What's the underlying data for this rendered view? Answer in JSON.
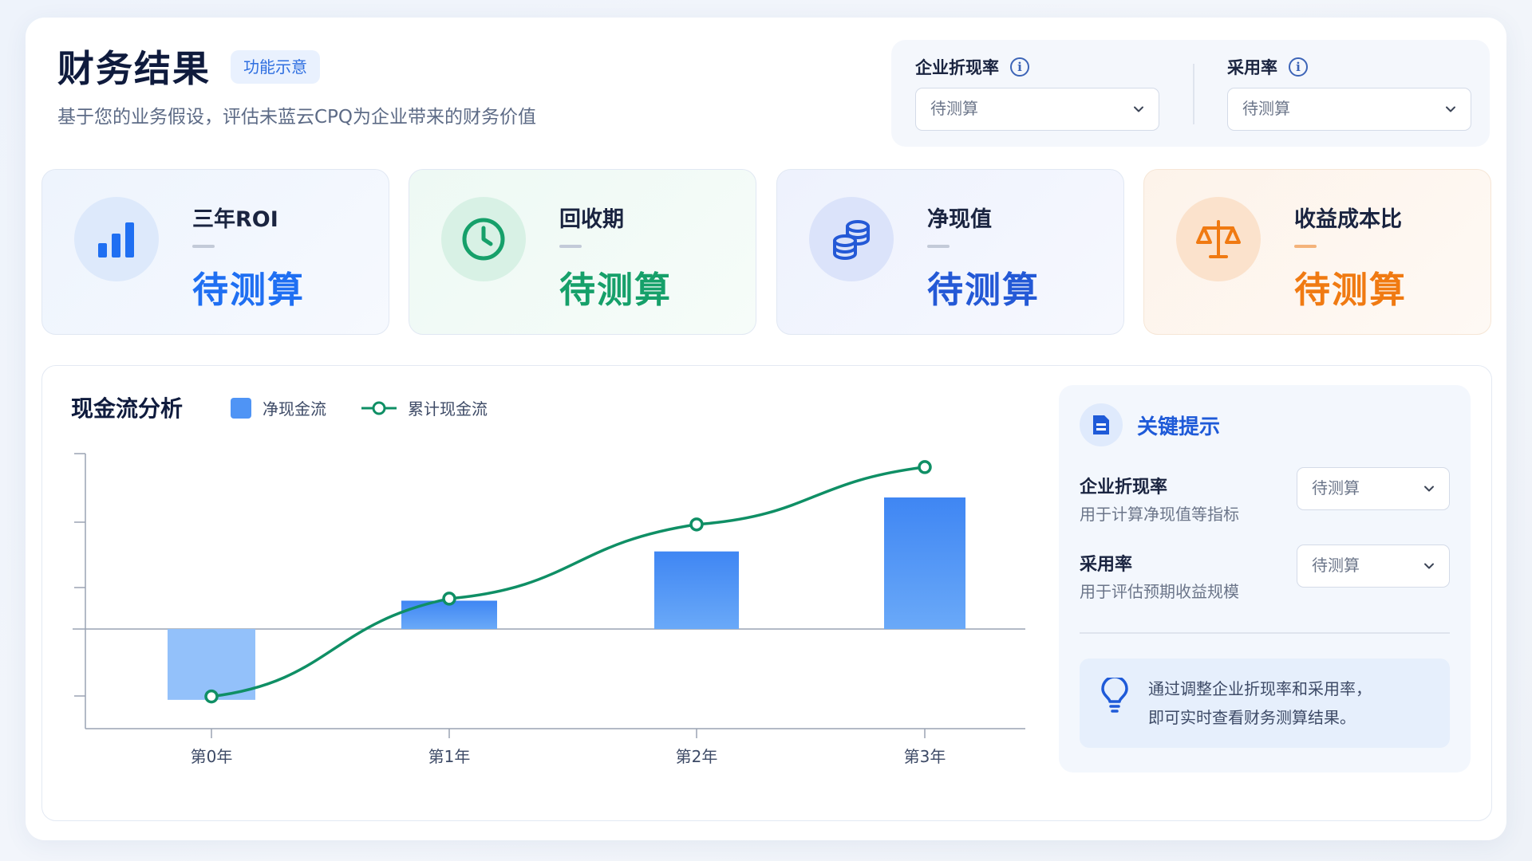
{
  "header": {
    "title": "财务结果",
    "badge": "功能示意",
    "subtitle": "基于您的业务假设，评估未蓝云CPQ为企业带来的财务价值"
  },
  "params": {
    "discount_rate": {
      "label": "企业折现率",
      "value": "待测算"
    },
    "adoption_rate": {
      "label": "采用率",
      "value": "待测算"
    }
  },
  "kpis": [
    {
      "title": "三年ROI",
      "value": "待测算",
      "icon": "bar-chart-icon",
      "accent": "#1f6ff2"
    },
    {
      "title": "回收期",
      "value": "待测算",
      "icon": "clock-icon",
      "accent": "#16a06a"
    },
    {
      "title": "净现值",
      "value": "待测算",
      "icon": "coins-icon",
      "accent": "#2459d6"
    },
    {
      "title": "收益成本比",
      "value": "待测算",
      "icon": "scale-icon",
      "accent": "#f07a12"
    }
  ],
  "cashflow": {
    "title": "现金流分析",
    "legend_bar": "净现金流",
    "legend_line": "累计现金流"
  },
  "chart_data": {
    "type": "bar",
    "categories": [
      "第0年",
      "第1年",
      "第2年",
      "第3年"
    ],
    "series": [
      {
        "name": "净现金流",
        "type": "bar",
        "values": [
          -1.05,
          0.42,
          1.15,
          1.95
        ],
        "color": "#4f94f5"
      },
      {
        "name": "累计现金流",
        "type": "line",
        "values": [
          -1.0,
          0.45,
          1.55,
          2.4
        ],
        "color": "#0f8f65"
      }
    ],
    "ylim": [
      -1.5,
      2.6
    ],
    "grid": false
  },
  "tips": {
    "title": "关键提示",
    "rows": [
      {
        "label": "企业折现率",
        "desc": "用于计算净现值等指标",
        "value": "待测算"
      },
      {
        "label": "采用率",
        "desc": "用于评估预期收益规模",
        "value": "待测算"
      }
    ],
    "hint_line1": "通过调整企业折现率和采用率，",
    "hint_line2": "即可实时查看财务测算结果。"
  }
}
